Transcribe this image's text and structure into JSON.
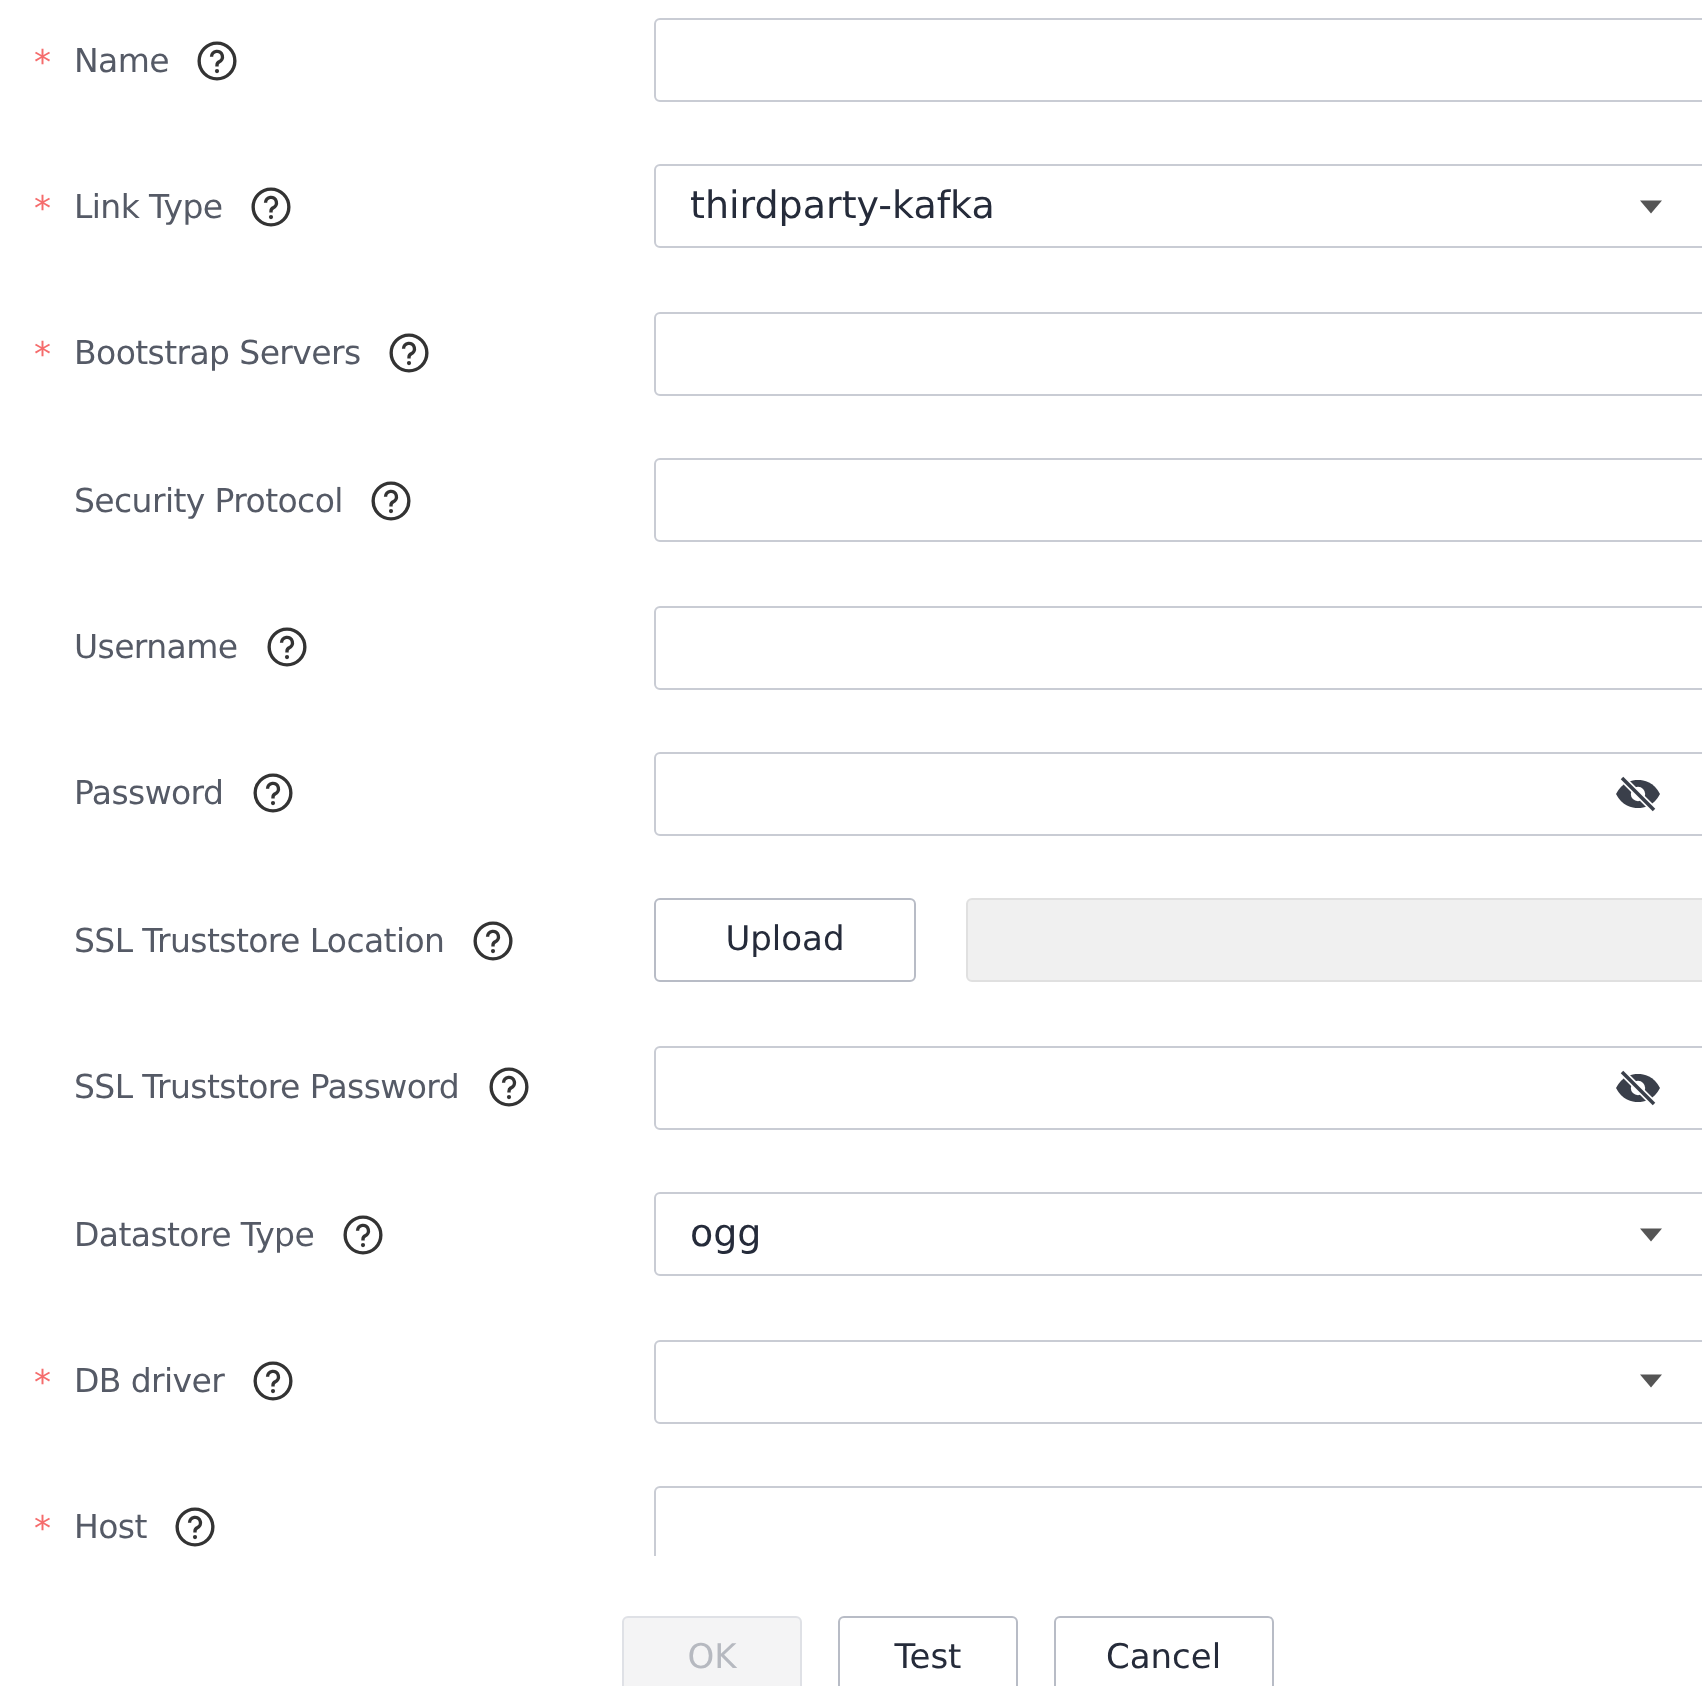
{
  "fields": [
    {
      "kind": "text",
      "label": "Name",
      "marker": "*"
    },
    {
      "kind": "select",
      "label": "Link Type",
      "marker": "*",
      "value": "thirdparty-kafka"
    },
    {
      "kind": "text",
      "label": "Bootstrap Servers",
      "marker": "*"
    },
    {
      "kind": "text",
      "label": "Security Protocol"
    },
    {
      "kind": "text",
      "label": "Username"
    },
    {
      "kind": "password",
      "label": "Password"
    },
    {
      "kind": "upload",
      "label": "SSL Truststore Location",
      "button": "Upload"
    },
    {
      "kind": "password",
      "label": "SSL Truststore Password"
    },
    {
      "kind": "select",
      "label": "Datastore Type",
      "value": "ogg"
    },
    {
      "kind": "select",
      "label": "DB driver",
      "marker": "*"
    },
    {
      "kind": "text",
      "label": "Host",
      "marker": "*"
    }
  ],
  "buttons": [
    {
      "label": "OK",
      "disabled": true
    },
    {
      "label": "Test",
      "disabled": false
    },
    {
      "label": "Cancel",
      "disabled": false
    }
  ]
}
